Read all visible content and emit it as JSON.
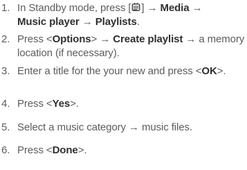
{
  "steps": [
    {
      "num": "1.",
      "parts": [
        {
          "t": "In Standby mode, press ["
        },
        {
          "icon": "menu-key-icon"
        },
        {
          "t": "] → "
        },
        {
          "t": "Media",
          "b": true
        },
        {
          "t": " → "
        },
        {
          "t": "Music player",
          "b": true
        },
        {
          "t": " → "
        },
        {
          "t": "Playlists",
          "b": true
        },
        {
          "t": "."
        }
      ]
    },
    {
      "num": "2.",
      "parts": [
        {
          "t": "Press <"
        },
        {
          "t": "Options",
          "b": true
        },
        {
          "t": "> → "
        },
        {
          "t": "Create playlist",
          "b": true
        },
        {
          "t": " → a memory location (if necessary)."
        }
      ]
    },
    {
      "num": "3.",
      "parts": [
        {
          "t": "Enter a title for the your new and press <"
        },
        {
          "t": "OK",
          "b": true
        },
        {
          "t": ">."
        }
      ]
    },
    {
      "num": "4.",
      "parts": [
        {
          "t": "Press <"
        },
        {
          "t": "Yes",
          "b": true
        },
        {
          "t": ">."
        }
      ]
    },
    {
      "num": "5.",
      "parts": [
        {
          "t": "Select a music category → music files."
        }
      ]
    },
    {
      "num": "6.",
      "parts": [
        {
          "t": "Press <"
        },
        {
          "t": "Done",
          "b": true
        },
        {
          "t": ">."
        }
      ]
    }
  ]
}
